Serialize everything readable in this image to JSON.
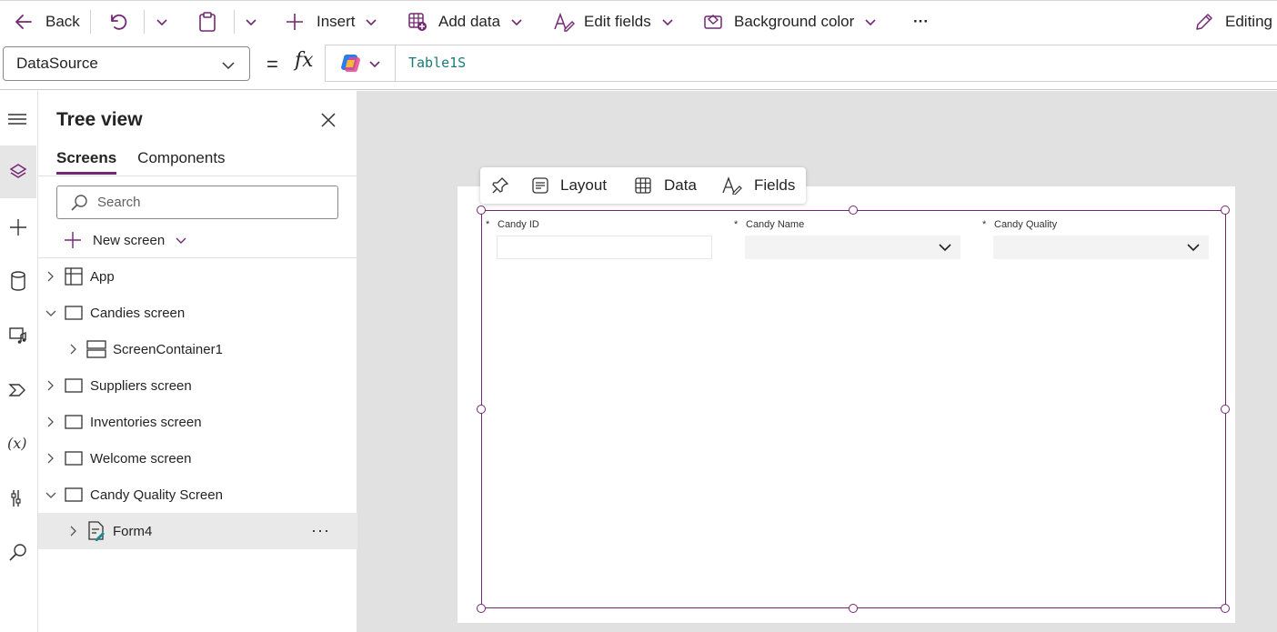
{
  "toolbar": {
    "back": "Back",
    "insert": "Insert",
    "add_data": "Add data",
    "edit_fields": "Edit fields",
    "background_color": "Background color",
    "more": "···",
    "editing": "Editing"
  },
  "formula_bar": {
    "property": "DataSource",
    "equals": "=",
    "fx": "fx",
    "formula": "Table1S"
  },
  "tree_view": {
    "title": "Tree view",
    "tabs": [
      "Screens",
      "Components"
    ],
    "search_placeholder": "Search",
    "new_screen": "New screen",
    "nodes": [
      {
        "label": "App",
        "icon": "app-icon",
        "expanded": false,
        "level": 0
      },
      {
        "label": "Candies screen",
        "icon": "screen-icon",
        "expanded": true,
        "level": 0
      },
      {
        "label": "ScreenContainer1",
        "icon": "container-icon",
        "expanded": false,
        "level": 1
      },
      {
        "label": "Suppliers screen",
        "icon": "screen-icon",
        "expanded": false,
        "level": 0
      },
      {
        "label": "Inventories screen",
        "icon": "screen-icon",
        "expanded": false,
        "level": 0
      },
      {
        "label": "Welcome screen",
        "icon": "screen-icon",
        "expanded": false,
        "level": 0
      },
      {
        "label": "Candy Quality Screen",
        "icon": "screen-icon",
        "expanded": true,
        "level": 0
      },
      {
        "label": "Form4",
        "icon": "form-icon",
        "expanded": false,
        "level": 1,
        "selected": true
      }
    ],
    "more": "···"
  },
  "canvas": {
    "float_bar": {
      "layout": "Layout",
      "data": "Data",
      "fields": "Fields"
    },
    "form_fields": [
      {
        "label": "Candy ID",
        "required": "*",
        "control": "text"
      },
      {
        "label": "Candy Name",
        "required": "*",
        "control": "dropdown"
      },
      {
        "label": "Candy Quality",
        "required": "*",
        "control": "dropdown"
      }
    ]
  },
  "colors": {
    "accent": "#742774",
    "canvas_bg": "#e1e1e1",
    "formula_text": "#1b7a7a"
  }
}
